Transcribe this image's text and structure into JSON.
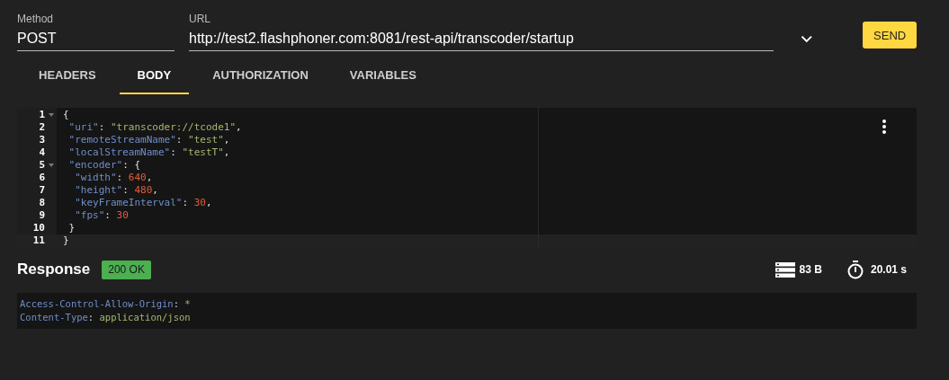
{
  "request": {
    "method": {
      "label": "Method",
      "value": "POST"
    },
    "url": {
      "label": "URL",
      "value": "http://test2.flashphoner.com:8081/rest-api/transcoder/startup"
    },
    "send_button": "SEND"
  },
  "tabs": [
    {
      "label": "HEADERS",
      "selected": false
    },
    {
      "label": "BODY",
      "selected": true
    },
    {
      "label": "AUTHORIZATION",
      "selected": false
    },
    {
      "label": "VARIABLES",
      "selected": false
    }
  ],
  "editor": {
    "lines": [
      {
        "number": "1",
        "foldable": true,
        "active": false,
        "tokens": [
          {
            "kind": "punct",
            "text": "{"
          }
        ]
      },
      {
        "number": "2",
        "foldable": false,
        "active": false,
        "tokens": [
          {
            "kind": "key",
            "text": " \"uri\""
          },
          {
            "kind": "punct",
            "text": ": "
          },
          {
            "kind": "string",
            "text": "\"transcoder://tcode1\""
          },
          {
            "kind": "punct",
            "text": ","
          }
        ]
      },
      {
        "number": "3",
        "foldable": false,
        "active": false,
        "tokens": [
          {
            "kind": "key",
            "text": " \"remoteStreamName\""
          },
          {
            "kind": "punct",
            "text": ": "
          },
          {
            "kind": "string",
            "text": "\"test\""
          },
          {
            "kind": "punct",
            "text": ","
          }
        ]
      },
      {
        "number": "4",
        "foldable": false,
        "active": false,
        "tokens": [
          {
            "kind": "key",
            "text": " \"localStreamName\""
          },
          {
            "kind": "punct",
            "text": ": "
          },
          {
            "kind": "string",
            "text": "\"testT\""
          },
          {
            "kind": "punct",
            "text": ","
          }
        ]
      },
      {
        "number": "5",
        "foldable": true,
        "active": false,
        "tokens": [
          {
            "kind": "key",
            "text": " \"encoder\""
          },
          {
            "kind": "punct",
            "text": ": {"
          }
        ]
      },
      {
        "number": "6",
        "foldable": false,
        "active": false,
        "tokens": [
          {
            "kind": "key",
            "text": "  \"width\""
          },
          {
            "kind": "punct",
            "text": ": "
          },
          {
            "kind": "number",
            "text": "640"
          },
          {
            "kind": "punct",
            "text": ","
          }
        ]
      },
      {
        "number": "7",
        "foldable": false,
        "active": false,
        "tokens": [
          {
            "kind": "key",
            "text": "  \"height\""
          },
          {
            "kind": "punct",
            "text": ": "
          },
          {
            "kind": "number",
            "text": "480"
          },
          {
            "kind": "punct",
            "text": ","
          }
        ]
      },
      {
        "number": "8",
        "foldable": false,
        "active": false,
        "tokens": [
          {
            "kind": "key",
            "text": "  \"keyFrameInterval\""
          },
          {
            "kind": "punct",
            "text": ": "
          },
          {
            "kind": "number",
            "text": "30"
          },
          {
            "kind": "punct",
            "text": ","
          }
        ]
      },
      {
        "number": "9",
        "foldable": false,
        "active": false,
        "tokens": [
          {
            "kind": "key",
            "text": "  \"fps\""
          },
          {
            "kind": "punct",
            "text": ": "
          },
          {
            "kind": "number",
            "text": "30"
          }
        ]
      },
      {
        "number": "10",
        "foldable": false,
        "active": false,
        "tokens": [
          {
            "kind": "punct",
            "text": " }"
          }
        ]
      },
      {
        "number": "11",
        "foldable": false,
        "active": true,
        "tokens": [
          {
            "kind": "punct",
            "text": "}"
          }
        ]
      }
    ]
  },
  "response": {
    "title": "Response",
    "status": "200 OK",
    "size": "83 B",
    "time": "20.01 s",
    "headers": [
      {
        "name": "Access-Control-Allow-Origin",
        "separator": ":",
        "value": "*"
      },
      {
        "name": "Content-Type",
        "separator": ":",
        "value": "application/json"
      }
    ]
  }
}
